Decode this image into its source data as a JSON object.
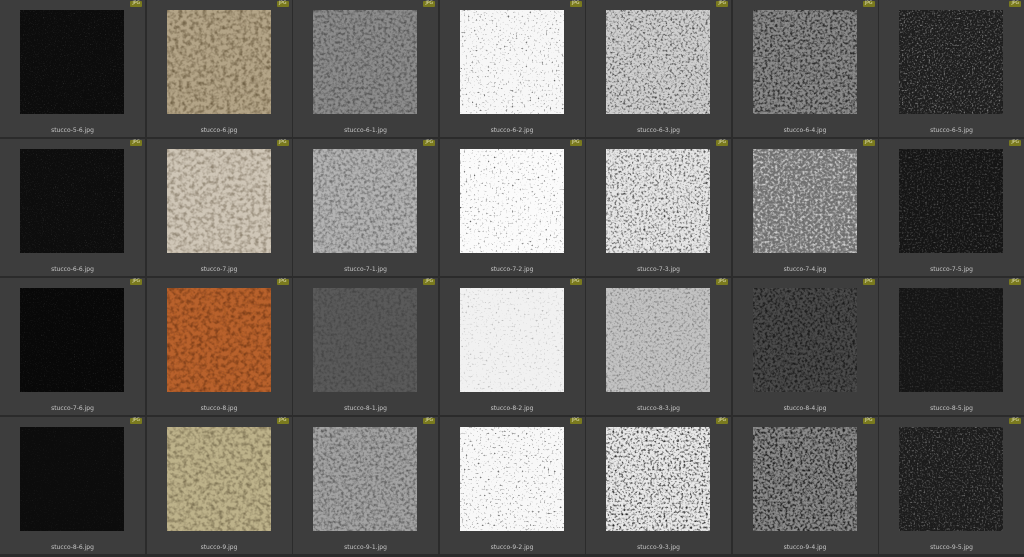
{
  "badge_label": "JPG",
  "files": [
    {
      "name": "stucco-5-6.jpg",
      "style": "black",
      "base": "#0c0c0c",
      "spec": "#4a4a4a"
    },
    {
      "name": "stucco-6.jpg",
      "style": "color",
      "base": "#b3a487",
      "spec": "#6f6045"
    },
    {
      "name": "stucco-6-1.jpg",
      "style": "gray",
      "base": "#8c8c8c",
      "spec": "#505050"
    },
    {
      "name": "stucco-6-2.jpg",
      "style": "white",
      "base": "#f7f7f7",
      "spec": "#222222"
    },
    {
      "name": "stucco-6-3.jpg",
      "style": "light",
      "base": "#cfcfcf",
      "spec": "#3a3a3a"
    },
    {
      "name": "stucco-6-4.jpg",
      "style": "mid",
      "base": "#8a8a8a",
      "spec": "#2a2a2a"
    },
    {
      "name": "stucco-6-5.jpg",
      "style": "dark",
      "base": "#1e1e1e",
      "spec": "#9a9a9a"
    },
    {
      "name": "stucco-6-6.jpg",
      "style": "black",
      "base": "#0d0d0d",
      "spec": "#4a4a4a"
    },
    {
      "name": "stucco-7.jpg",
      "style": "color",
      "base": "#cfc6b7",
      "spec": "#8f8472"
    },
    {
      "name": "stucco-7-1.jpg",
      "style": "gray",
      "base": "#b3b3b3",
      "spec": "#6c6c6c"
    },
    {
      "name": "stucco-7-2.jpg",
      "style": "white",
      "base": "#fbfbfb",
      "spec": "#303030"
    },
    {
      "name": "stucco-7-3.jpg",
      "style": "light",
      "base": "#e6e6e6",
      "spec": "#3c3c3c"
    },
    {
      "name": "stucco-7-4.jpg",
      "style": "mid",
      "base": "#707070",
      "spec": "#cfcfcf"
    },
    {
      "name": "stucco-7-5.jpg",
      "style": "dark",
      "base": "#151515",
      "spec": "#5a5a5a"
    },
    {
      "name": "stucco-7-6.jpg",
      "style": "black",
      "base": "#080808",
      "spec": "#3a3a3a"
    },
    {
      "name": "stucco-8.jpg",
      "style": "color",
      "base": "#b8612c",
      "spec": "#7a3c17"
    },
    {
      "name": "stucco-8-1.jpg",
      "style": "gray",
      "base": "#5a5a5a",
      "spec": "#444444"
    },
    {
      "name": "stucco-8-2.jpg",
      "style": "white",
      "base": "#f1f1f1",
      "spec": "#9a9a9a"
    },
    {
      "name": "stucco-8-3.jpg",
      "style": "light",
      "base": "#c2c2c2",
      "spec": "#7a7a7a"
    },
    {
      "name": "stucco-8-4.jpg",
      "style": "mid",
      "base": "#4a4a4a",
      "spec": "#1a1a1a"
    },
    {
      "name": "stucco-8-5.jpg",
      "style": "dark",
      "base": "#151515",
      "spec": "#3a3a3a"
    },
    {
      "name": "stucco-8-6.jpg",
      "style": "black",
      "base": "#0c0c0c",
      "spec": "#2a2a2a"
    },
    {
      "name": "stucco-9.jpg",
      "style": "color",
      "base": "#bdb28a",
      "spec": "#7b7052"
    },
    {
      "name": "stucco-9-1.jpg",
      "style": "gray",
      "base": "#a3a3a3",
      "spec": "#5c5c5c"
    },
    {
      "name": "stucco-9-2.jpg",
      "style": "white",
      "base": "#f8f8f8",
      "spec": "#111111"
    },
    {
      "name": "stucco-9-3.jpg",
      "style": "light",
      "base": "#e8e8e8",
      "spec": "#1a1a1a"
    },
    {
      "name": "stucco-9-4.jpg",
      "style": "mid",
      "base": "#8a8a8a",
      "spec": "#1a1a1a"
    },
    {
      "name": "stucco-9-5.jpg",
      "style": "dark",
      "base": "#1c1c1c",
      "spec": "#7a7a7a"
    }
  ]
}
